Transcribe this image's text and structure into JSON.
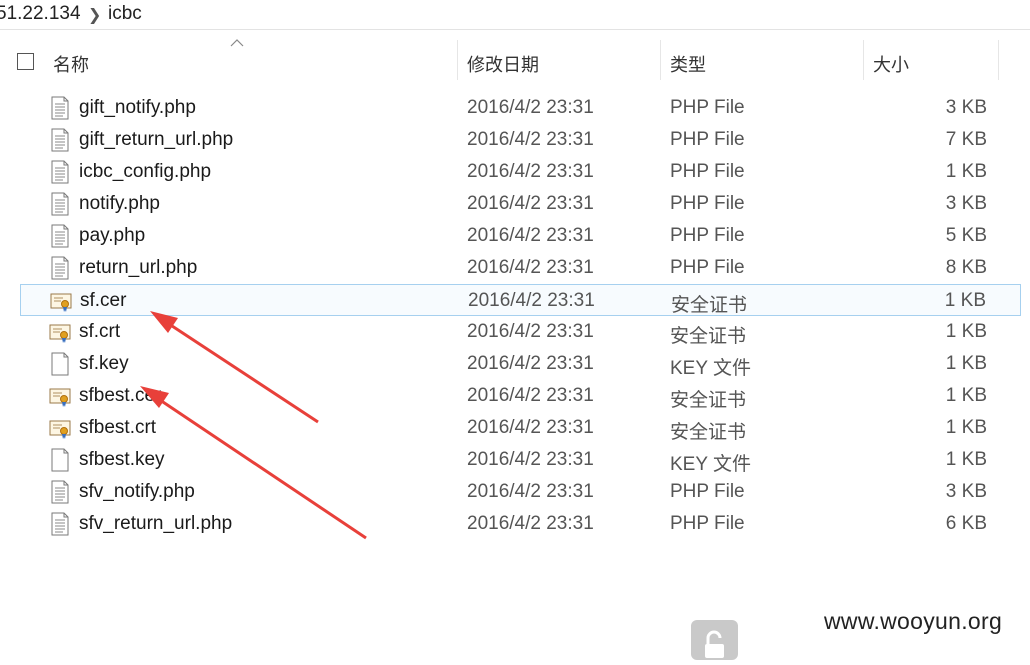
{
  "breadcrumb": {
    "parent": "51.22.134",
    "separator_icon": "chevron-right-icon",
    "current": "icbc"
  },
  "columns": {
    "name": "名称",
    "modified": "修改日期",
    "type": "类型",
    "size": "大小",
    "sort_icon": "sort-ascending-icon"
  },
  "files": [
    {
      "name": "gift_notify.php",
      "date": "2016/4/2 23:31",
      "type": "PHP File",
      "size": "3 KB",
      "icon": "document-icon"
    },
    {
      "name": "gift_return_url.php",
      "date": "2016/4/2 23:31",
      "type": "PHP File",
      "size": "7 KB",
      "icon": "document-icon"
    },
    {
      "name": "icbc_config.php",
      "date": "2016/4/2 23:31",
      "type": "PHP File",
      "size": "1 KB",
      "icon": "document-icon"
    },
    {
      "name": "notify.php",
      "date": "2016/4/2 23:31",
      "type": "PHP File",
      "size": "3 KB",
      "icon": "document-icon"
    },
    {
      "name": "pay.php",
      "date": "2016/4/2 23:31",
      "type": "PHP File",
      "size": "5 KB",
      "icon": "document-icon"
    },
    {
      "name": "return_url.php",
      "date": "2016/4/2 23:31",
      "type": "PHP File",
      "size": "8 KB",
      "icon": "document-icon"
    },
    {
      "name": "sf.cer",
      "date": "2016/4/2 23:31",
      "type": "安全证书",
      "size": "1 KB",
      "icon": "certificate-icon",
      "selected": true
    },
    {
      "name": "sf.crt",
      "date": "2016/4/2 23:31",
      "type": "安全证书",
      "size": "1 KB",
      "icon": "certificate-icon"
    },
    {
      "name": "sf.key",
      "date": "2016/4/2 23:31",
      "type": "KEY 文件",
      "size": "1 KB",
      "icon": "blank-file-icon"
    },
    {
      "name": "sfbest.cer",
      "date": "2016/4/2 23:31",
      "type": "安全证书",
      "size": "1 KB",
      "icon": "certificate-icon"
    },
    {
      "name": "sfbest.crt",
      "date": "2016/4/2 23:31",
      "type": "安全证书",
      "size": "1 KB",
      "icon": "certificate-icon"
    },
    {
      "name": "sfbest.key",
      "date": "2016/4/2 23:31",
      "type": "KEY 文件",
      "size": "1 KB",
      "icon": "blank-file-icon"
    },
    {
      "name": "sfv_notify.php",
      "date": "2016/4/2 23:31",
      "type": "PHP File",
      "size": "3 KB",
      "icon": "document-icon"
    },
    {
      "name": "sfv_return_url.php",
      "date": "2016/4/2 23:31",
      "type": "PHP File",
      "size": "6 KB",
      "icon": "document-icon"
    }
  ],
  "annotations": {
    "arrow_color": "#e8403a",
    "arrow_targets": [
      "sf.cer",
      "sf.key"
    ]
  },
  "watermark": "www.wooyun.org",
  "bottom_button_icon": "unlock-icon",
  "colors": {
    "selection_border": "#a6d0ef",
    "selection_fill": "#f7fbfe",
    "secondary_text": "#555555"
  }
}
